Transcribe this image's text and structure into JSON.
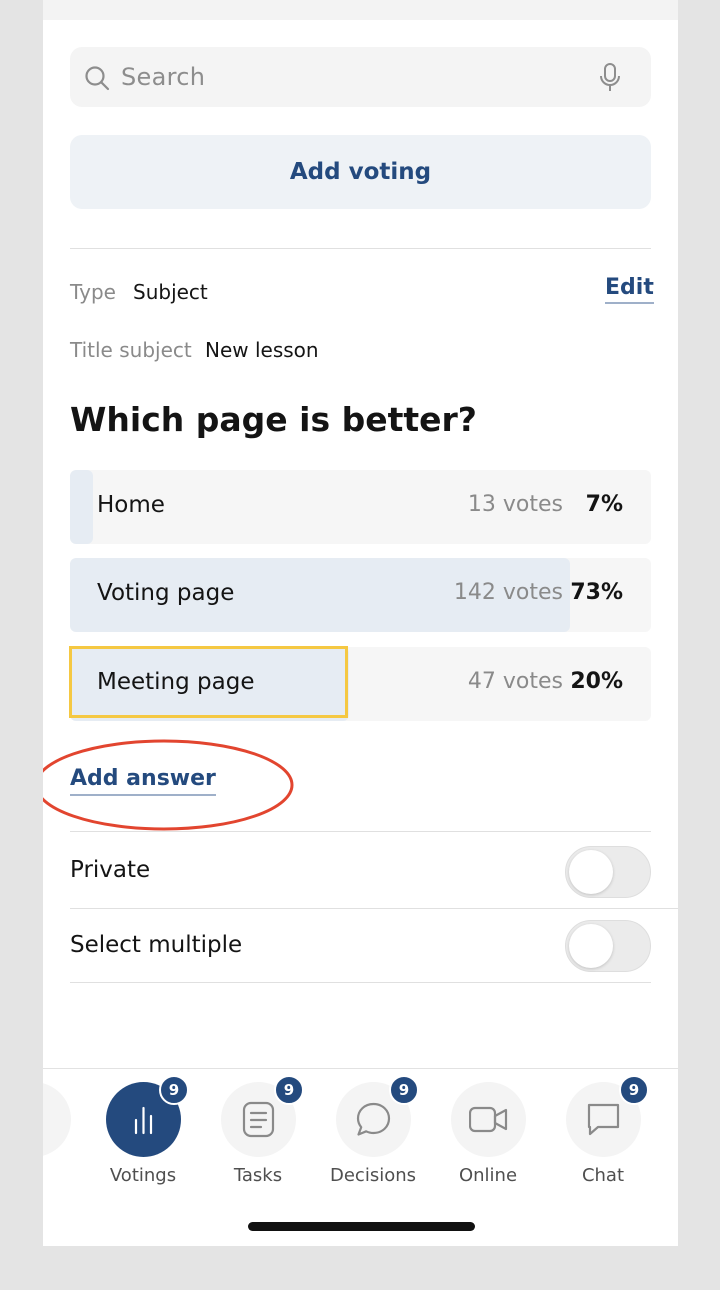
{
  "search": {
    "placeholder": "Search",
    "icon": "search-icon",
    "voice_icon": "microphone-icon"
  },
  "add_voting_label": "Add voting",
  "meta": {
    "type_label": "Type",
    "type_value": "Subject",
    "title_label": "Title subject",
    "title_value": "New lesson",
    "edit_label": "Edit"
  },
  "question": "Which page is better?",
  "options": [
    {
      "label": "Home",
      "votes": "13 votes",
      "percent": "7%",
      "share": 0.04,
      "selected": false
    },
    {
      "label": "Voting page",
      "votes": "142 votes",
      "percent": "73%",
      "share": 0.86,
      "selected": false
    },
    {
      "label": "Meeting page",
      "votes": "47 votes",
      "percent": "20%",
      "share": 0.48,
      "selected": true
    }
  ],
  "add_answer_label": "Add answer",
  "settings": [
    {
      "label": "Private",
      "on": false
    },
    {
      "label": "Select multiple",
      "on": false
    }
  ],
  "nav": {
    "partial_label": "s",
    "items": [
      {
        "label": "Votings",
        "badge": "9",
        "icon": "bar-chart-icon",
        "active": true
      },
      {
        "label": "Tasks",
        "badge": "9",
        "icon": "document-icon",
        "active": false
      },
      {
        "label": "Decisions",
        "badge": "9",
        "icon": "chat-bubble-icon",
        "active": false
      },
      {
        "label": "Online",
        "badge": "",
        "icon": "video-camera-icon",
        "active": false
      },
      {
        "label": "Chat",
        "badge": "9",
        "icon": "message-square-icon",
        "active": false
      }
    ]
  },
  "colors": {
    "accent": "#244a7e",
    "option_bg": "#f6f6f6",
    "option_fill": "#e6ecf3",
    "selected_border": "#f5c842",
    "annotation": "#e2452f"
  }
}
